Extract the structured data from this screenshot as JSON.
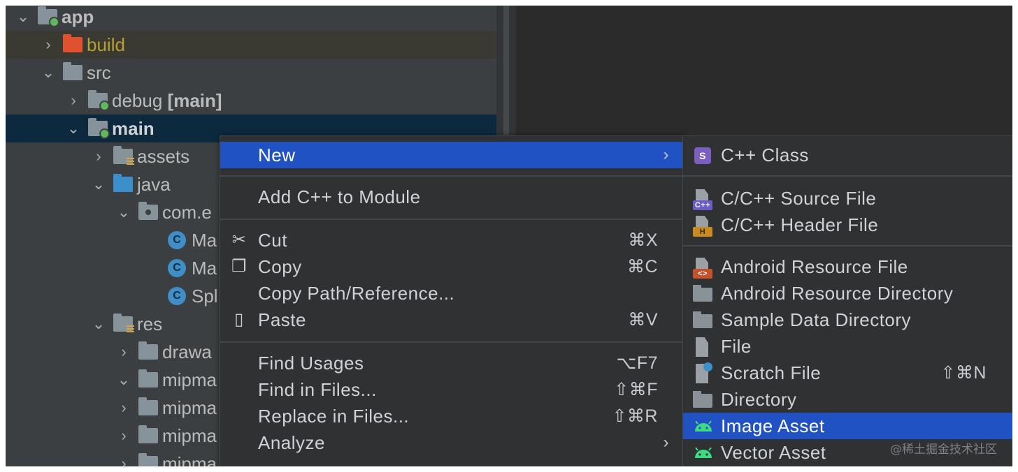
{
  "tree": {
    "rows": [
      {
        "label": "app",
        "bold": true
      },
      {
        "label": "build"
      },
      {
        "label": "src"
      },
      {
        "label": "debug",
        "suffix": "[main]"
      },
      {
        "label": "main",
        "bold": true
      },
      {
        "label": "assets"
      },
      {
        "label": "java"
      },
      {
        "label": "com.e"
      },
      {
        "label": "Ma"
      },
      {
        "label": "Ma"
      },
      {
        "label": "Spl"
      },
      {
        "label": "res"
      },
      {
        "label": "drawa"
      },
      {
        "label": "mipma"
      },
      {
        "label": "mipma"
      },
      {
        "label": "mipma"
      },
      {
        "label": "mipma"
      }
    ],
    "class_badge": "C"
  },
  "context_menu": {
    "items": [
      {
        "label": "New",
        "arrow": "›"
      },
      {
        "label": "Add C++ to Module"
      },
      {
        "label": "Cut",
        "shortcut": "⌘X",
        "icon": "scissors-icon"
      },
      {
        "label": "Copy",
        "shortcut": "⌘C",
        "icon": "copy-icon"
      },
      {
        "label": "Copy Path/Reference..."
      },
      {
        "label": "Paste",
        "shortcut": "⌘V",
        "icon": "clipboard-icon"
      },
      {
        "label": "Find Usages",
        "shortcut": "⌥F7"
      },
      {
        "label": "Find in Files...",
        "shortcut": "⇧⌘F"
      },
      {
        "label": "Replace in Files...",
        "shortcut": "⇧⌘R"
      },
      {
        "label": "Analyze",
        "arrow": "›"
      }
    ]
  },
  "submenu": {
    "items": [
      {
        "label": "C++ Class",
        "badge": "S"
      },
      {
        "label": "C/C++ Source File",
        "badge": "C++"
      },
      {
        "label": "C/C++ Header File",
        "badge": "H"
      },
      {
        "label": "Android Resource File",
        "badge": "<>"
      },
      {
        "label": "Android Resource Directory"
      },
      {
        "label": "Sample Data Directory"
      },
      {
        "label": "File"
      },
      {
        "label": "Scratch File",
        "shortcut": "⇧⌘N"
      },
      {
        "label": "Directory"
      },
      {
        "label": "Image Asset"
      },
      {
        "label": "Vector Asset"
      }
    ]
  },
  "watermark": "@稀土掘金技术社区",
  "colors": {
    "selection": "#2152c4",
    "tree_bg": "#3c3f41",
    "menu_bg": "#2f3133"
  }
}
